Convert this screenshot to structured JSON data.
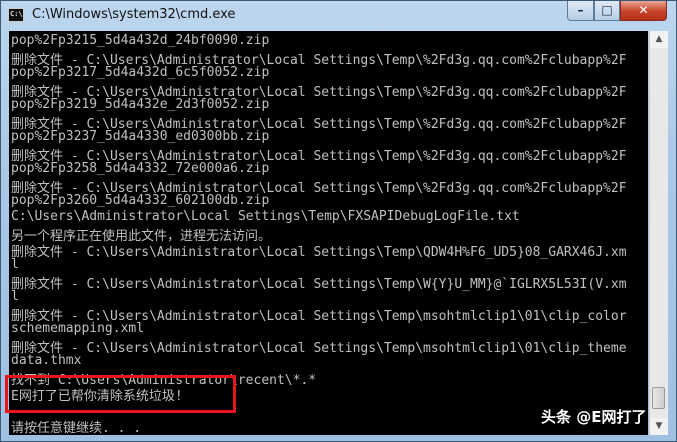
{
  "window": {
    "title": "C:\\Windows\\system32\\cmd.exe",
    "icon_label": "C:\\",
    "controls": {
      "minimize": "–",
      "maximize": "□",
      "close": "✕"
    }
  },
  "console": {
    "lines": [
      "pop%2Fp3215_5d4a432d_24bf0090.zip",
      "删除文件 - C:\\Users\\Administrator\\Local Settings\\Temp\\%2Fd3g.qq.com%2Fclubapp%2F",
      "pop%2Fp3217_5d4a432d_6c5f0052.zip",
      "删除文件 - C:\\Users\\Administrator\\Local Settings\\Temp\\%2Fd3g.qq.com%2Fclubapp%2F",
      "pop%2Fp3219_5d4a432e_2d3f0052.zip",
      "删除文件 - C:\\Users\\Administrator\\Local Settings\\Temp\\%2Fd3g.qq.com%2Fclubapp%2F",
      "pop%2Fp3237_5d4a4330_ed0300bb.zip",
      "删除文件 - C:\\Users\\Administrator\\Local Settings\\Temp\\%2Fd3g.qq.com%2Fclubapp%2F",
      "pop%2Fp3258_5d4a4332_72e000a6.zip",
      "删除文件 - C:\\Users\\Administrator\\Local Settings\\Temp\\%2Fd3g.qq.com%2Fclubapp%2F",
      "pop%2Fp3260_5d4a4332_602100db.zip",
      "C:\\Users\\Administrator\\Local Settings\\Temp\\FXSAPIDebugLogFile.txt",
      "另一个程序正在使用此文件，进程无法访问。",
      "删除文件 - C:\\Users\\Administrator\\Local Settings\\Temp\\QDW4H%F6_UD5}08_GARX46J.xm",
      "l",
      "删除文件 - C:\\Users\\Administrator\\Local Settings\\Temp\\W{Y}U_MM}@`IGLRX5L53I(V.xm",
      "l",
      "删除文件 - C:\\Users\\Administrator\\Local Settings\\Temp\\msohtmlclip1\\01\\clip_color",
      "schememapping.xml",
      "删除文件 - C:\\Users\\Administrator\\Local Settings\\Temp\\msohtmlclip1\\01\\clip_theme",
      "data.thmx",
      "找不到 C:\\Users\\Administrator\\recent\\*.*",
      "E网打了已帮你清除系统垃圾!",
      "",
      "请按任意键继续. . ."
    ]
  },
  "scrollbar": {
    "up_arrow": "▲",
    "down_arrow": "▼"
  },
  "watermark": "头条 @E网打了"
}
